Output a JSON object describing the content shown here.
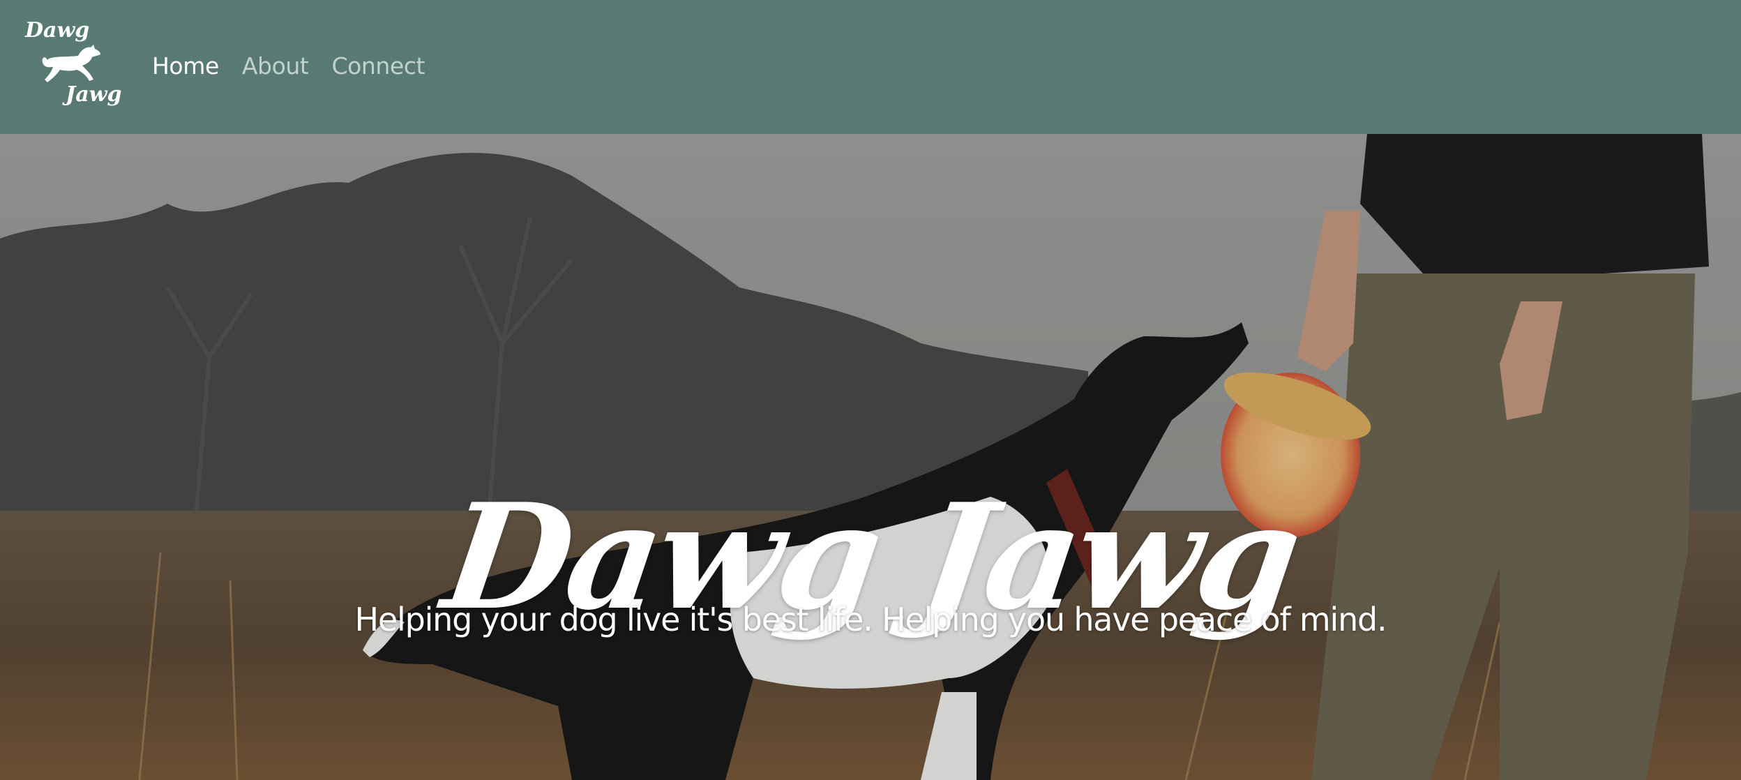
{
  "brand": {
    "logo_top_text": "Dawg",
    "logo_bottom_text": "Jawg",
    "logo_icon": "running-dog-icon"
  },
  "nav": {
    "items": [
      {
        "label": "Home",
        "active": true
      },
      {
        "label": "About",
        "active": false
      },
      {
        "label": "Connect",
        "active": false
      }
    ]
  },
  "hero": {
    "title": "Dawg Jawg",
    "subtitle": "Helping your dog live it's best life. Helping you have peace of mind.",
    "background_image": "border collie catching a frisbee in a field next to a person"
  },
  "colors": {
    "navbar": "#597a72",
    "nav_active": "#ffffff",
    "nav_inactive": "#c2d1cc",
    "hero_text": "#ffffff"
  }
}
